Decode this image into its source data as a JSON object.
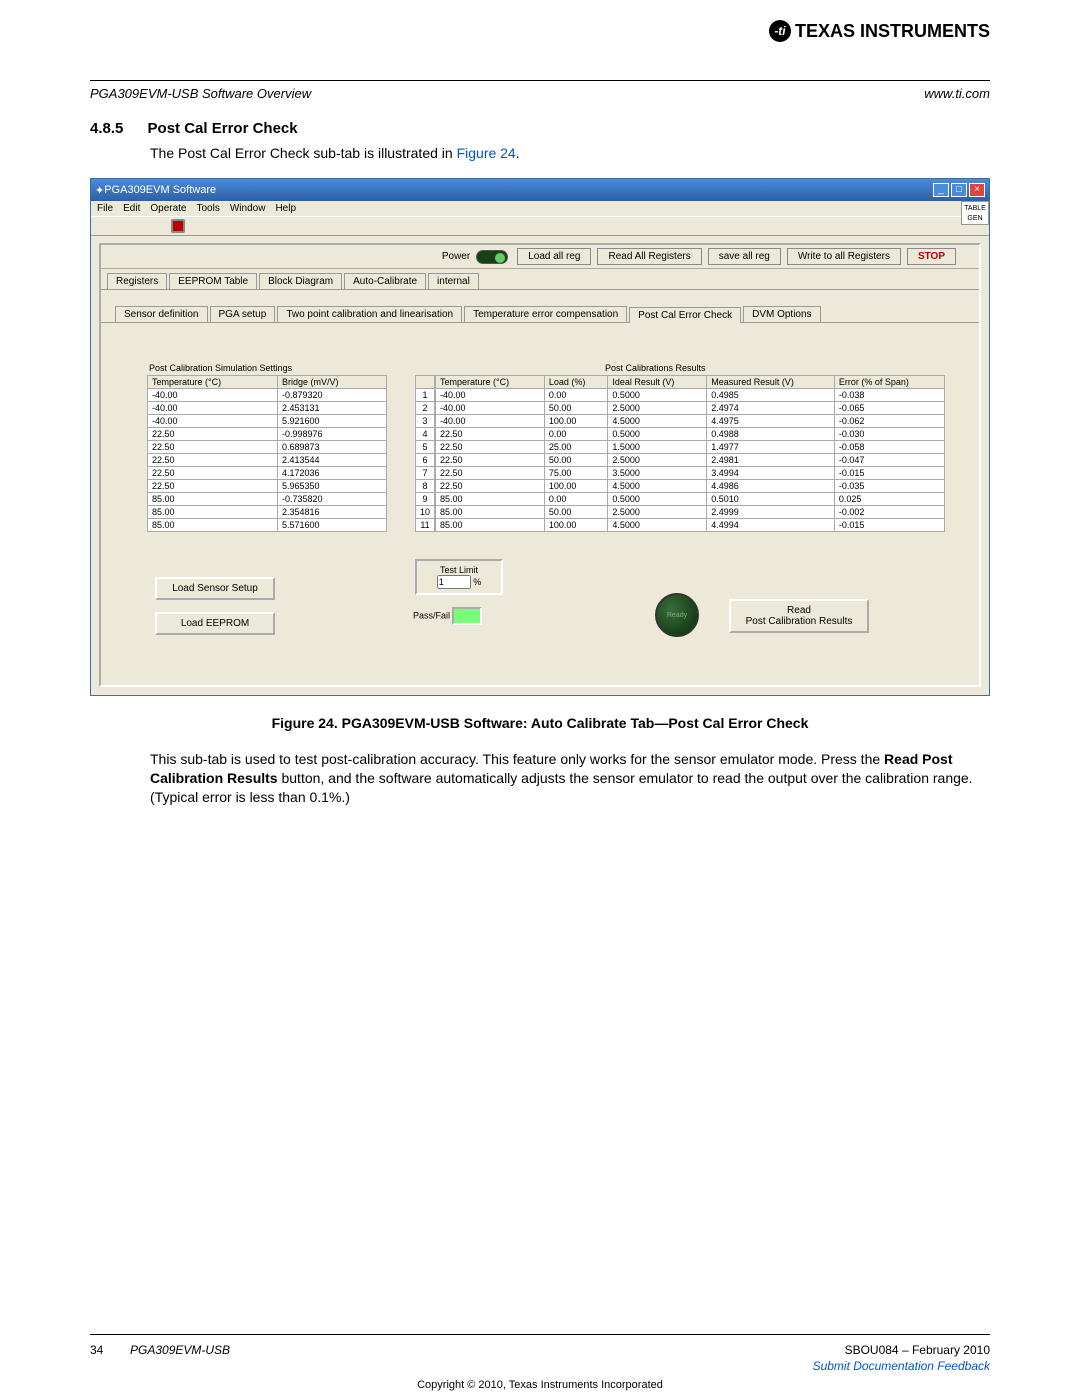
{
  "doc": {
    "header_brand": "TEXAS INSTRUMENTS",
    "section_left": "PGA309EVM-USB Software Overview",
    "section_right": "www.ti.com",
    "sec_num": "4.8.5",
    "sec_title": "Post Cal Error Check",
    "intro_pre": "The Post Cal Error Check sub-tab is illustrated in ",
    "intro_link": "Figure 24",
    "intro_post": ".",
    "caption": "Figure 24. PGA309EVM-USB Software: Auto Calibrate Tab—Post Cal Error Check",
    "body1": "This sub-tab is used to test post-calibration accuracy. This feature only works for the sensor emulator mode. Press the ",
    "body_bold": "Read Post Calibration Results",
    "body2": " button, and the software automatically adjusts the sensor emulator to read the output over the calibration range. (Typical error is less than 0.1%.)",
    "page_num": "34",
    "footer_title": "PGA309EVM-USB",
    "footer_doc": "SBOU084 – February 2010",
    "footer_link": "Submit Documentation Feedback",
    "copyright": "Copyright © 2010, Texas Instruments Incorporated"
  },
  "app": {
    "title": "PGA309EVM Software",
    "menu": [
      "File",
      "Edit",
      "Operate",
      "Tools",
      "Window",
      "Help"
    ],
    "side_badge": "TABLE GEN",
    "toolbar": {
      "power": "Power",
      "load_all_reg": "Load all reg",
      "read_all": "Read All Registers",
      "save_all": "save all reg",
      "write_all": "Write to all Registers",
      "stop": "STOP"
    },
    "main_tabs": [
      "Registers",
      "EEPROM Table",
      "Block Diagram",
      "Auto-Calibrate",
      "internal"
    ],
    "main_active": 3,
    "sub_tabs": [
      "Sensor definition",
      "PGA setup",
      "Two point calibration and linearisation",
      "Temperature error compensation",
      "Post Cal Error Check",
      "DVM Options"
    ],
    "sub_active": 4,
    "left_label": "Post Calibration Simulation Settings",
    "right_label": "Post Calibrations Results",
    "left_headers": [
      "Temperature (°C)",
      "Bridge (mV/V)"
    ],
    "left_rows": [
      [
        "-40.00",
        "-0.879320"
      ],
      [
        "-40.00",
        "2.453131"
      ],
      [
        "-40.00",
        "5.921600"
      ],
      [
        "22.50",
        "-0.998976"
      ],
      [
        "22.50",
        "0.689873"
      ],
      [
        "22.50",
        "2.413544"
      ],
      [
        "22.50",
        "4.172036"
      ],
      [
        "22.50",
        "5.965350"
      ],
      [
        "85.00",
        "-0.735820"
      ],
      [
        "85.00",
        "2.354816"
      ],
      [
        "85.00",
        "5.571600"
      ]
    ],
    "right_headers": [
      "Temperature (°C)",
      "Load (%)",
      "Ideal Result (V)",
      "Measured Result (V)",
      "Error (% of Span)"
    ],
    "right_rows": [
      [
        "-40.00",
        "0.00",
        "0.5000",
        "0.4985",
        "-0.038"
      ],
      [
        "-40.00",
        "50.00",
        "2.5000",
        "2.4974",
        "-0.065"
      ],
      [
        "-40.00",
        "100.00",
        "4.5000",
        "4.4975",
        "-0.062"
      ],
      [
        "22.50",
        "0.00",
        "0.5000",
        "0.4988",
        "-0.030"
      ],
      [
        "22.50",
        "25.00",
        "1.5000",
        "1.4977",
        "-0.058"
      ],
      [
        "22.50",
        "50.00",
        "2.5000",
        "2.4981",
        "-0.047"
      ],
      [
        "22.50",
        "75.00",
        "3.5000",
        "3.4994",
        "-0.015"
      ],
      [
        "22.50",
        "100.00",
        "4.5000",
        "4.4986",
        "-0.035"
      ],
      [
        "85.00",
        "0.00",
        "0.5000",
        "0.5010",
        "0.025"
      ],
      [
        "85.00",
        "50.00",
        "2.5000",
        "2.4999",
        "-0.002"
      ],
      [
        "85.00",
        "100.00",
        "4.5000",
        "4.4994",
        "-0.015"
      ]
    ],
    "btn_load_sensor": "Load Sensor Setup",
    "btn_load_eeprom": "Load EEPROM",
    "test_limit_label": "Test Limit",
    "test_limit_value": "1",
    "test_limit_unit": "%",
    "passfail_label": "Pass/Fail",
    "ready_label": "Ready",
    "read_results_l1": "Read",
    "read_results_l2": "Post Calibration Results"
  }
}
